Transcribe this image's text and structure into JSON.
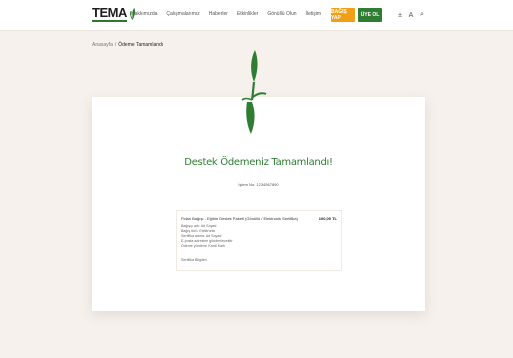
{
  "header": {
    "logo_text": "TEMA",
    "nav": [
      "Hakkımızda",
      "Çalışmalarımız",
      "Haberler",
      "Etkinlikler",
      "Gönüllü Olun",
      "İletişim"
    ],
    "donate_label": "BAĞIŞ YAP",
    "member_label": "ÜYE OL",
    "accessibility_symbol": "±",
    "font_size_symbol": "A",
    "search_symbol": "⌕"
  },
  "breadcrumb": {
    "home": "Anasayfa",
    "separator": "/",
    "current": "Ödeme Tamamlandı"
  },
  "card": {
    "title": "Destek Ödemeniz Tamamlandı!",
    "subtitle": "İşlem No: 1234567890"
  },
  "summary": {
    "product": "Fidan Bağışı - Eğitim Destek Paketi (Gönüllü / Elektronik Sertifika)",
    "amount": "100,00 TL",
    "lines": [
      "Bağışçı adı: Ad Soyad",
      "Bağış türü: Elektronik",
      "Sertifika adına: Ad Soyad",
      "E-posta adresine gönderilecektir",
      "Ödeme yöntemi: Kredi Kartı"
    ],
    "footer": "Sertifika Bilgileri"
  },
  "colors": {
    "brand_green": "#2e7d32",
    "accent_orange": "#f0a017",
    "page_bg": "#f6f1ed"
  }
}
